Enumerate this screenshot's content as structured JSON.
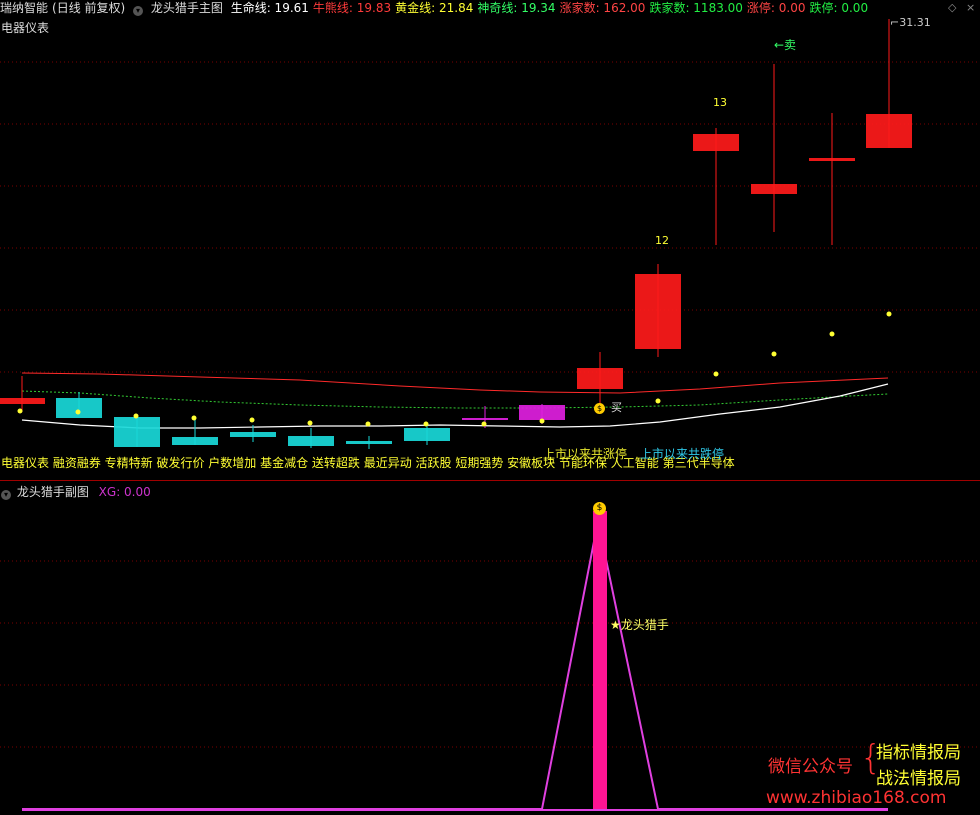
{
  "header": {
    "stock": "瑞纳智能",
    "period": "(日线 前复权)",
    "indicator_name": "龙头猎手主图",
    "items": [
      {
        "label": "生命线:",
        "value": "19.61",
        "color": "#ffffff"
      },
      {
        "label": "牛熊线:",
        "value": "19.83",
        "color": "#ff3b3b"
      },
      {
        "label": "黄金线:",
        "value": "21.84",
        "color": "#ffff33"
      },
      {
        "label": "神奇线:",
        "value": "19.34",
        "color": "#33ff66"
      },
      {
        "label": "涨家数:",
        "value": "162.00",
        "color": "#ff4444"
      },
      {
        "label": "跌家数:",
        "value": "1183.00",
        "color": "#22ee44"
      },
      {
        "label": "涨停:",
        "value": "0.00",
        "color": "#ff4444"
      },
      {
        "label": "跌停:",
        "value": "0.00",
        "color": "#22ee44"
      }
    ],
    "subtitle": "电器仪表"
  },
  "main_chart": {
    "labels": {
      "sell": "←卖",
      "buy": "买",
      "peak": "31.31",
      "count_13": "13",
      "count_12": "12"
    },
    "concepts": "电器仪表 融资融券 专精特新 破发行价 户数增加 基金减仓 送转超跌 最近异动 活跃股 短期强势 安徽板块 节能环保 人工智能 第三代半导体",
    "overlay_red": "上市以来共涨停",
    "overlay_cyan": "上市以来共跌停",
    "colors": {
      "up": "#ff1a1a",
      "cyan": "#19d9d9",
      "magenta": "#e020e0",
      "yellow": "#ffff33",
      "white": "#ffffff",
      "red_line": "#ff2a2a",
      "green_line": "#33cc33"
    }
  },
  "sub_chart": {
    "title": "龙头猎手副图",
    "xg_label": "XG: 0.00",
    "signal": "★龙头猎手",
    "colors": {
      "bar": "#ff1493",
      "line": "#e040e0"
    }
  },
  "watermark": {
    "wechat": "微信公众号",
    "line1": "指标情报局",
    "line2": "战法情报局",
    "url": "www.zhibiao168.com"
  }
}
